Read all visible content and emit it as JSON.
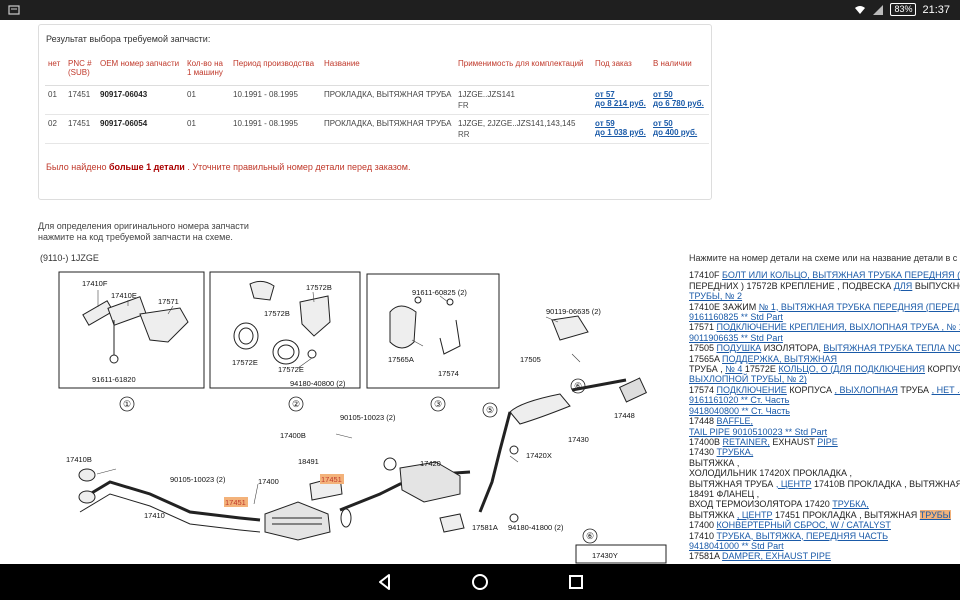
{
  "status": {
    "battery": "83%",
    "time": "21:37",
    "icons": [
      "notification-icon",
      "wifi-icon",
      "signal-icon",
      "battery-icon"
    ]
  },
  "panel": {
    "title": "Результат выбора требуемой запчасти:",
    "headers": [
      "нет",
      "PNC # (SUB)",
      "OEM номер запчасти",
      "Кол-во на 1 машину",
      "Период производства",
      "Название",
      "Применимость для комплектаций",
      "Под заказ",
      "В наличии"
    ],
    "rows": [
      {
        "no": "01",
        "pnc": "17451",
        "oem": "90917-06043",
        "qty": "01",
        "period": "10.1991 - 08.1995",
        "name": "ПРОКЛАДКА, ВЫТЯЖНАЯ ТРУБА",
        "app1": "1JZGE..JZS141",
        "app2": "FR",
        "order1": "от 57",
        "order2": "до 8 214 руб.",
        "stock1": "от 50",
        "stock2": "до 6 780 руб."
      },
      {
        "no": "02",
        "pnc": "17451",
        "oem": "90917-06054",
        "qty": "01",
        "period": "10.1991 - 08.1995",
        "name": "ПРОКЛАДКА, ВЫТЯЖНАЯ ТРУБА",
        "app1": "1JZGE, 2JZGE..JZS141,143,145",
        "app2": "RR",
        "order1": "от 59",
        "order2": "до 1 038 руб.",
        "stock1": "от 50",
        "stock2": "до 400 руб."
      }
    ],
    "found_pre": "Было найдено",
    "found_bold": "больше 1 детали",
    "found_post": ". Уточните правильный номер детали перед заказом."
  },
  "instructions": {
    "line1": "Для определения оригинального номера запчасти",
    "line2": "нажмите на код требуемой запчасти на схеме."
  },
  "model": "(9110-) 1JZGE",
  "diagram": {
    "boxes": [
      "①",
      "②",
      "③"
    ],
    "labels": [
      "17410F",
      "17410E",
      "17571",
      "91611-61820",
      "17572B",
      "17572B",
      "17572E",
      "17572E",
      "94180-40800 (2)",
      "91611-60825 (2)",
      "17565A",
      "17574",
      "90119-06635 (2)",
      "17505",
      "17448",
      "17430",
      "17420X",
      "90105-10023 (2)",
      "17400B",
      "17410B",
      "90105-10023 (2)",
      "17400",
      "18491",
      "17451",
      "17451",
      "17420",
      "17410",
      "17581A",
      "94180-41800 (2)",
      "17430Y"
    ],
    "circled": [
      "⑥",
      "⑤",
      "⑥",
      "⑥"
    ]
  },
  "right": {
    "hint": "Нажмите на номер детали на схеме или на название детали в с",
    "lines": [
      [
        {
          "t": "17410F "
        },
        {
          "t": "БОЛТ ИЛИ КОЛЬЦО, ВЫТЯЖНАЯ ТРУБКА ПЕРЕДНЯЯ (ДЛ",
          "a": true
        }
      ],
      [
        {
          "t": "ПЕРЕДНИХ ) 17572B КРЕПЛЕНИЕ , ПОДВЕСКА "
        },
        {
          "t": "ДЛЯ",
          "a": true
        },
        {
          "t": " ВЫПУСКНО"
        }
      ],
      [
        {
          "t": "ТРУБЫ, № 2",
          "a": true
        }
      ],
      [
        {
          "t": "17410E ЗАЖИМ "
        },
        {
          "t": "№ 1, ВЫТЯЖНАЯ ТРУБКА ПЕРЕДНЯЯ (ПЕРЕДН",
          "a": true
        }
      ],
      [
        {
          "t": "9161160825 ** Std Part",
          "a": true
        }
      ],
      [
        {
          "t": "17571 "
        },
        {
          "t": "ПОДКЛЮЧЕНИЕ КРЕПЛЕНИЯ, ВЫХЛОПНАЯ ТРУБА , № 1",
          "a": true
        }
      ],
      [
        {
          "t": "9011906635 ** Std Part",
          "a": true
        }
      ],
      [
        {
          "t": "17505 "
        },
        {
          "t": "ПОДУШКА",
          "a": true
        },
        {
          "t": " ИЗОЛЯТОРА, "
        },
        {
          "t": "ВЫТЯЖНАЯ ТРУБКА ТЕПЛА NO.1",
          "a": true
        }
      ],
      [
        {
          "t": "17565A "
        },
        {
          "t": "ПОДДЕРЖКА, ВЫТЯЖНАЯ",
          "a": true
        }
      ],
      [
        {
          "t": "ТРУБА , "
        },
        {
          "t": "№ 4",
          "a": true
        },
        {
          "t": " 17572E "
        },
        {
          "t": "КОЛЬЦО, О (ДЛЯ ПОДКЛЮЧЕНИЯ",
          "a": true
        },
        {
          "t": " КОРПУСА"
        }
      ],
      [
        {
          "t": "ВЫХЛОПНОЙ ТРУБЫ, № 2)",
          "a": true
        }
      ],
      [
        {
          "t": "17574 "
        },
        {
          "t": "ПОДКЛЮЧЕНИЕ",
          "a": true
        },
        {
          "t": " КОРПУСА "
        },
        {
          "t": ", ВЫХЛОПНАЯ",
          "a": true
        },
        {
          "t": " ТРУБА "
        },
        {
          "t": ", НЕТ .4",
          "a": true
        }
      ],
      [
        {
          "t": "9161161020 ** Ст. Часть",
          "a": true
        }
      ],
      [
        {
          "t": "9418040800 ** Ст. Часть",
          "a": true
        }
      ],
      [
        {
          "t": "17448 "
        },
        {
          "t": "BAFFLE,",
          "a": true
        }
      ],
      [
        {
          "t": "TAIL PIPE 9010510023 ** Std Part",
          "a": true
        }
      ],
      [
        {
          "t": "17400B "
        },
        {
          "t": "RETAINER,",
          "a": true
        },
        {
          "t": " EXHAUST "
        },
        {
          "t": "PIPE",
          "a": true
        }
      ],
      [
        {
          "t": "17430 "
        },
        {
          "t": "ТРУБКА,",
          "a": true
        }
      ],
      [
        {
          "t": "ВЫТЯЖКА ,"
        }
      ],
      [
        {
          "t": "ХОЛОДИЛЬНИК 17420X ПРОКЛАДКА ,"
        }
      ],
      [
        {
          "t": "ВЫТЯЖНАЯ ТРУБА "
        },
        {
          "t": ", ЦЕНТР",
          "a": true
        },
        {
          "t": " 17410B ПРОКЛАДКА , ВЫТЯЖНАЯ ТР"
        }
      ],
      [
        {
          "t": "18491 ФЛАНЕЦ ,"
        }
      ],
      [
        {
          "t": "ВХОД ТЕРМОИЗОЛЯТОРА 17420 "
        },
        {
          "t": "ТРУБКА,",
          "a": true
        }
      ],
      [
        {
          "t": "ВЫТЯЖКА "
        },
        {
          "t": ", ЦЕНТР",
          "a": true
        },
        {
          "t": " 17451 ПРОКЛАДКА "
        },
        {
          "t": ", ",
          "a": false
        },
        {
          "t": "ВЫТЯЖНАЯ "
        },
        {
          "t": "ТРУБЫ",
          "h": true
        }
      ],
      [
        {
          "t": "17400 "
        },
        {
          "t": "КОНВЕРТЕРНЫЙ СБРОС, W / CATALYST",
          "a": true
        }
      ],
      [
        {
          "t": "17410 "
        },
        {
          "t": "ТРУБКА, ВЫТЯЖКА, ПЕРЕДНЯЯ ЧАСТЬ",
          "a": true
        }
      ],
      [
        {
          "t": "9418041000 ** Std Part",
          "a": true
        }
      ],
      [
        {
          "t": "17581A "
        },
        {
          "t": "DAMPER, EXHAUST PIPE",
          "a": true
        }
      ]
    ]
  },
  "nav": {
    "buttons": [
      "back",
      "home",
      "recents"
    ]
  }
}
